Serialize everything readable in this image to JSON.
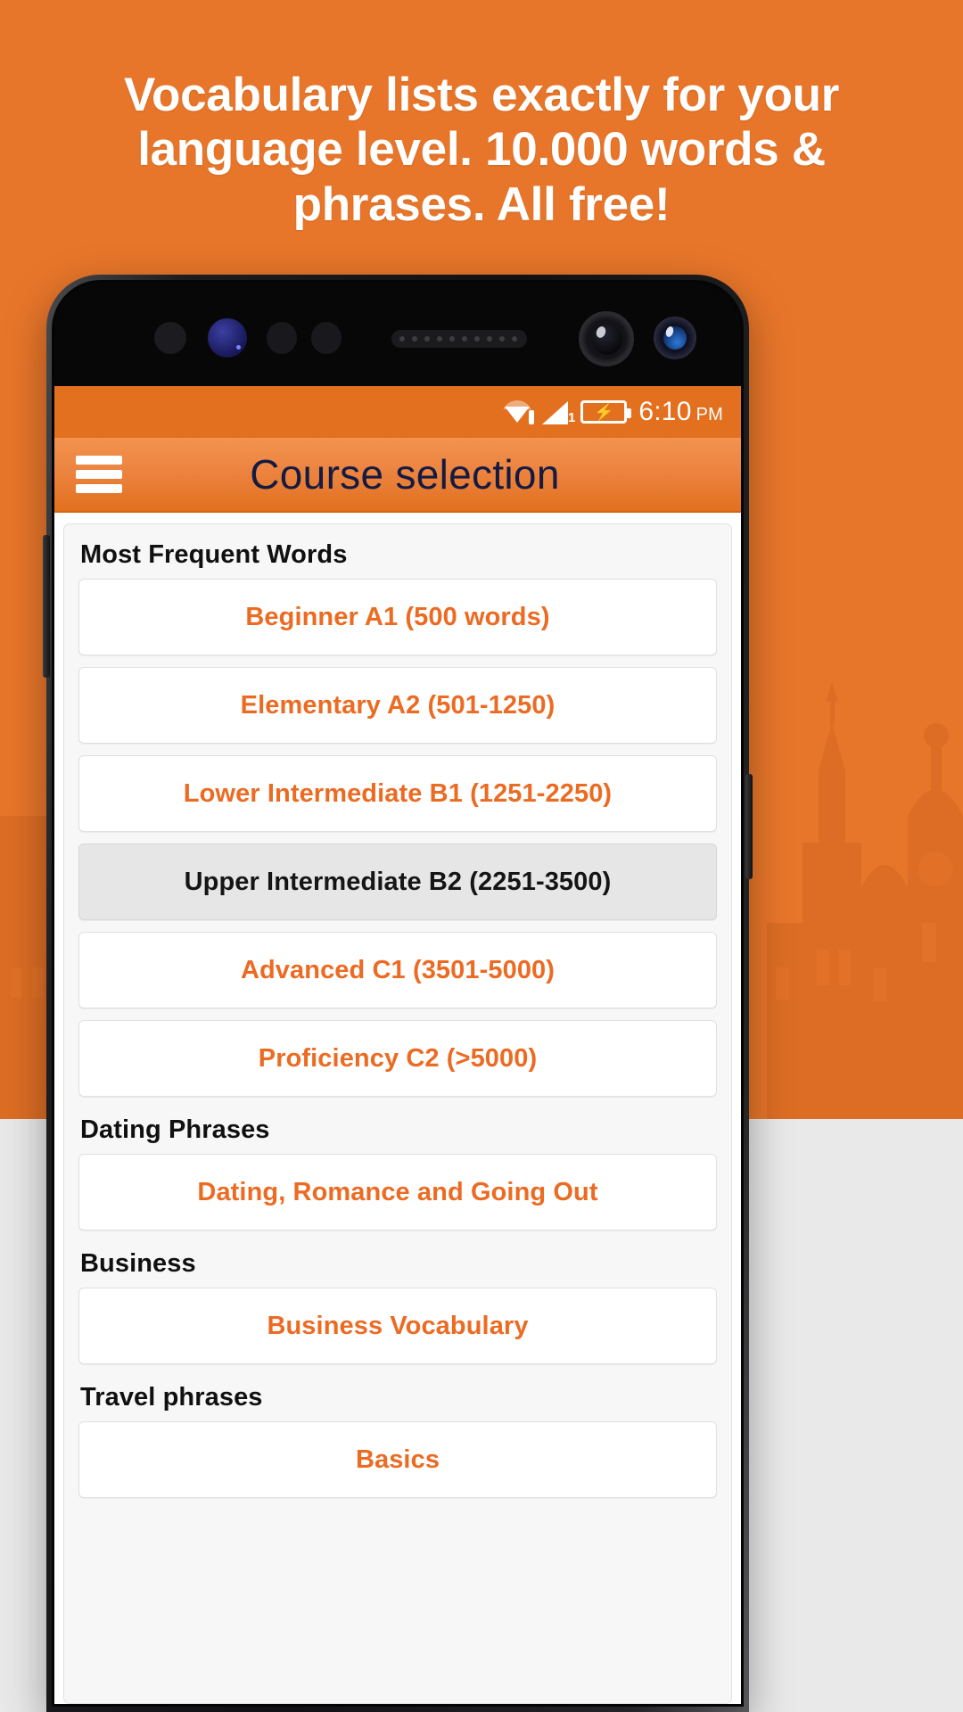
{
  "promo": {
    "headline": "Vocabulary lists exactly for your language level. 10.000 words & phrases. All free!",
    "background_color": "#e8762a",
    "accent_color": "#ec6b23"
  },
  "status_bar": {
    "wifi_icon": "wifi-icon",
    "signal_icon": "cellular-signal-icon",
    "signal_slot": "1",
    "battery_icon": "battery-charging-icon",
    "battery_bolt": "⚡",
    "time": "6:10",
    "period": "PM"
  },
  "app_bar": {
    "menu_icon": "hamburger-menu-icon",
    "title": "Course selection"
  },
  "sections": [
    {
      "header": "Most Frequent Words",
      "items": [
        {
          "label": "Beginner A1 (500 words)",
          "selected": false
        },
        {
          "label": "Elementary A2 (501-1250)",
          "selected": false
        },
        {
          "label": "Lower Intermediate B1 (1251-2250)",
          "selected": false
        },
        {
          "label": "Upper Intermediate B2 (2251-3500)",
          "selected": true
        },
        {
          "label": "Advanced C1 (3501-5000)",
          "selected": false
        },
        {
          "label": "Proficiency C2 (>5000)",
          "selected": false
        }
      ]
    },
    {
      "header": "Dating Phrases",
      "items": [
        {
          "label": "Dating, Romance and Going Out",
          "selected": false
        }
      ]
    },
    {
      "header": "Business",
      "items": [
        {
          "label": "Business Vocabulary",
          "selected": false
        }
      ]
    },
    {
      "header": "Travel phrases",
      "items": [
        {
          "label": "Basics",
          "selected": false
        }
      ]
    }
  ]
}
